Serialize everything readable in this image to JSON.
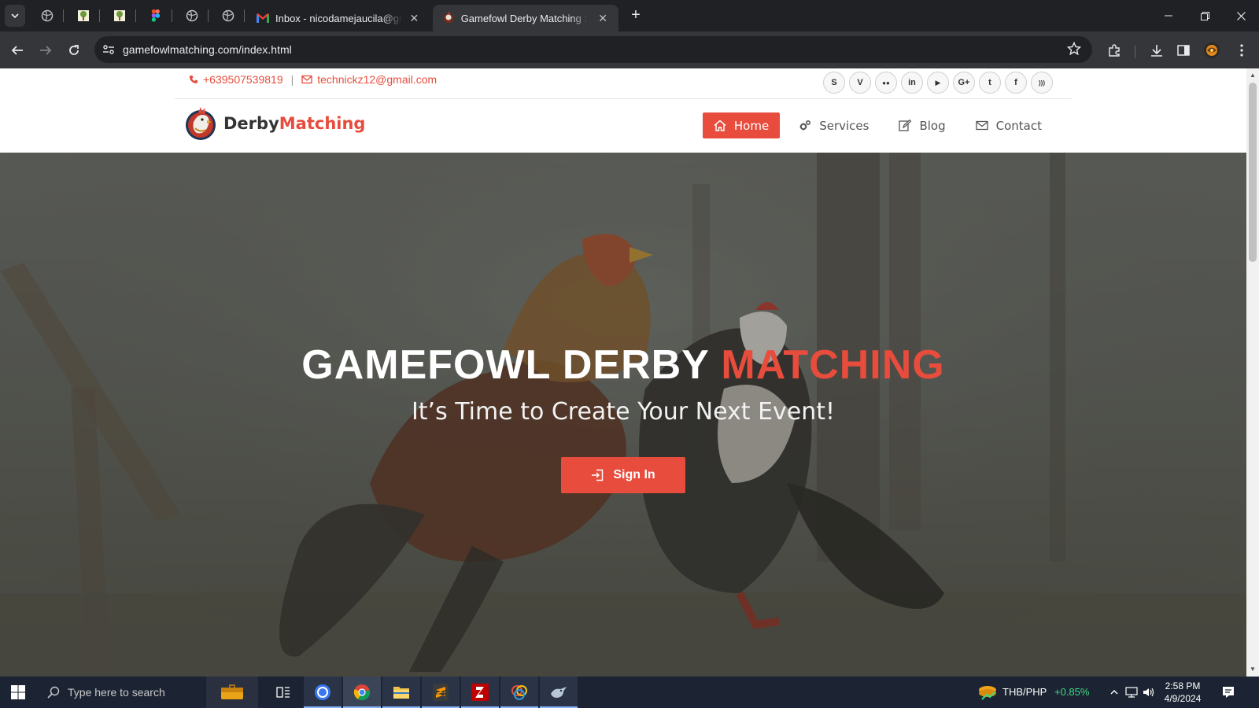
{
  "browser": {
    "tabs": [
      {
        "title": "Inbox - nicodamejaucila@gmail.com",
        "active": false
      },
      {
        "title": "Gamefowl Derby Matching : Free",
        "active": true
      }
    ],
    "new_tab": "+",
    "url": "gamefowlmatching.com/index.html"
  },
  "site": {
    "phone": "+639507539819",
    "separator": "|",
    "email": "technickz12@gmail.com",
    "socials": [
      "skype-icon",
      "vimeo-icon",
      "flickr-icon",
      "linkedin-icon",
      "youtube-icon",
      "google-plus-icon",
      "twitter-icon",
      "facebook-icon",
      "rss-icon"
    ],
    "social_labels": [
      "S",
      "V",
      "●●",
      "in",
      "▶",
      "G+",
      "t",
      "f",
      ")))"
    ],
    "brand_prefix": "Derby",
    "brand_suffix": "Matching",
    "menu": [
      {
        "label": "Home",
        "icon": "home-icon",
        "active": true
      },
      {
        "label": "Services",
        "icon": "gears-icon",
        "active": false
      },
      {
        "label": "Blog",
        "icon": "edit-icon",
        "active": false
      },
      {
        "label": "Contact",
        "icon": "envelope-icon",
        "active": false
      }
    ]
  },
  "hero": {
    "title_main": "GAMEFOWL DERBY ",
    "title_accent": "MATCHING",
    "subtitle": "It’s Time to Create Your Next Event!",
    "button": "Sign In"
  },
  "taskbar": {
    "search_placeholder": "Type here to search",
    "ticker_pair": "THB/PHP",
    "ticker_change": "+0.85%",
    "time": "2:58 PM",
    "date": "4/9/2024"
  },
  "colors": {
    "accent": "#e74c3c",
    "ticker_up": "#3ddc84"
  }
}
